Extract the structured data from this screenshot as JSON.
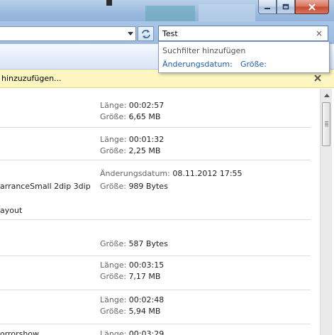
{
  "window": {
    "controls": [
      "minimize-icon",
      "maximize-icon",
      "close-icon"
    ]
  },
  "search": {
    "value": "Test",
    "clear_icon": "close-icon"
  },
  "search_popup": {
    "heading": "Suchfilter hinzufügen",
    "options": [
      "Änderungsdatum:",
      "Größe:"
    ]
  },
  "infobar": {
    "text": "hinzuzufügen...",
    "close_icon": "close-icon"
  },
  "results": [
    {
      "name": "",
      "line1_label": "Länge:",
      "line1_value": "00:02:57",
      "line2_label": "Größe:",
      "line2_value": "6,65 MB"
    },
    {
      "name": "",
      "line1_label": "Länge:",
      "line1_value": "00:01:32",
      "line2_label": "Größe:",
      "line2_value": "2,25 MB"
    },
    {
      "name": "arranceSmall 2dip 3dip",
      "line1_label": "Änderungsdatum:",
      "line1_value": "08.11.2012 17:55",
      "line2_label": "Größe:",
      "line2_value": "989 Bytes"
    },
    {
      "name": "ayout",
      "line1_label": "",
      "line1_value": "",
      "line2_label": "",
      "line2_value": ""
    },
    {
      "name": "",
      "line1_label": "",
      "line1_value": "",
      "line2_label": "Größe:",
      "line2_value": "587 Bytes"
    },
    {
      "name": "",
      "line1_label": "Länge:",
      "line1_value": "00:03:15",
      "line2_label": "Größe:",
      "line2_value": "7,17 MB"
    },
    {
      "name": "",
      "line1_label": "Länge:",
      "line1_value": "00:02:48",
      "line2_label": "Größe:",
      "line2_value": "5,94 MB"
    },
    {
      "name": "orrorshow",
      "line1_label": "Länge:",
      "line1_value": "00:03:29",
      "line2_label": "",
      "line2_value": ""
    }
  ],
  "colors": {
    "accent_link": "#1e5fb4",
    "infobar_bg": "#fdf6c0",
    "close_button": "#c34a2f"
  }
}
